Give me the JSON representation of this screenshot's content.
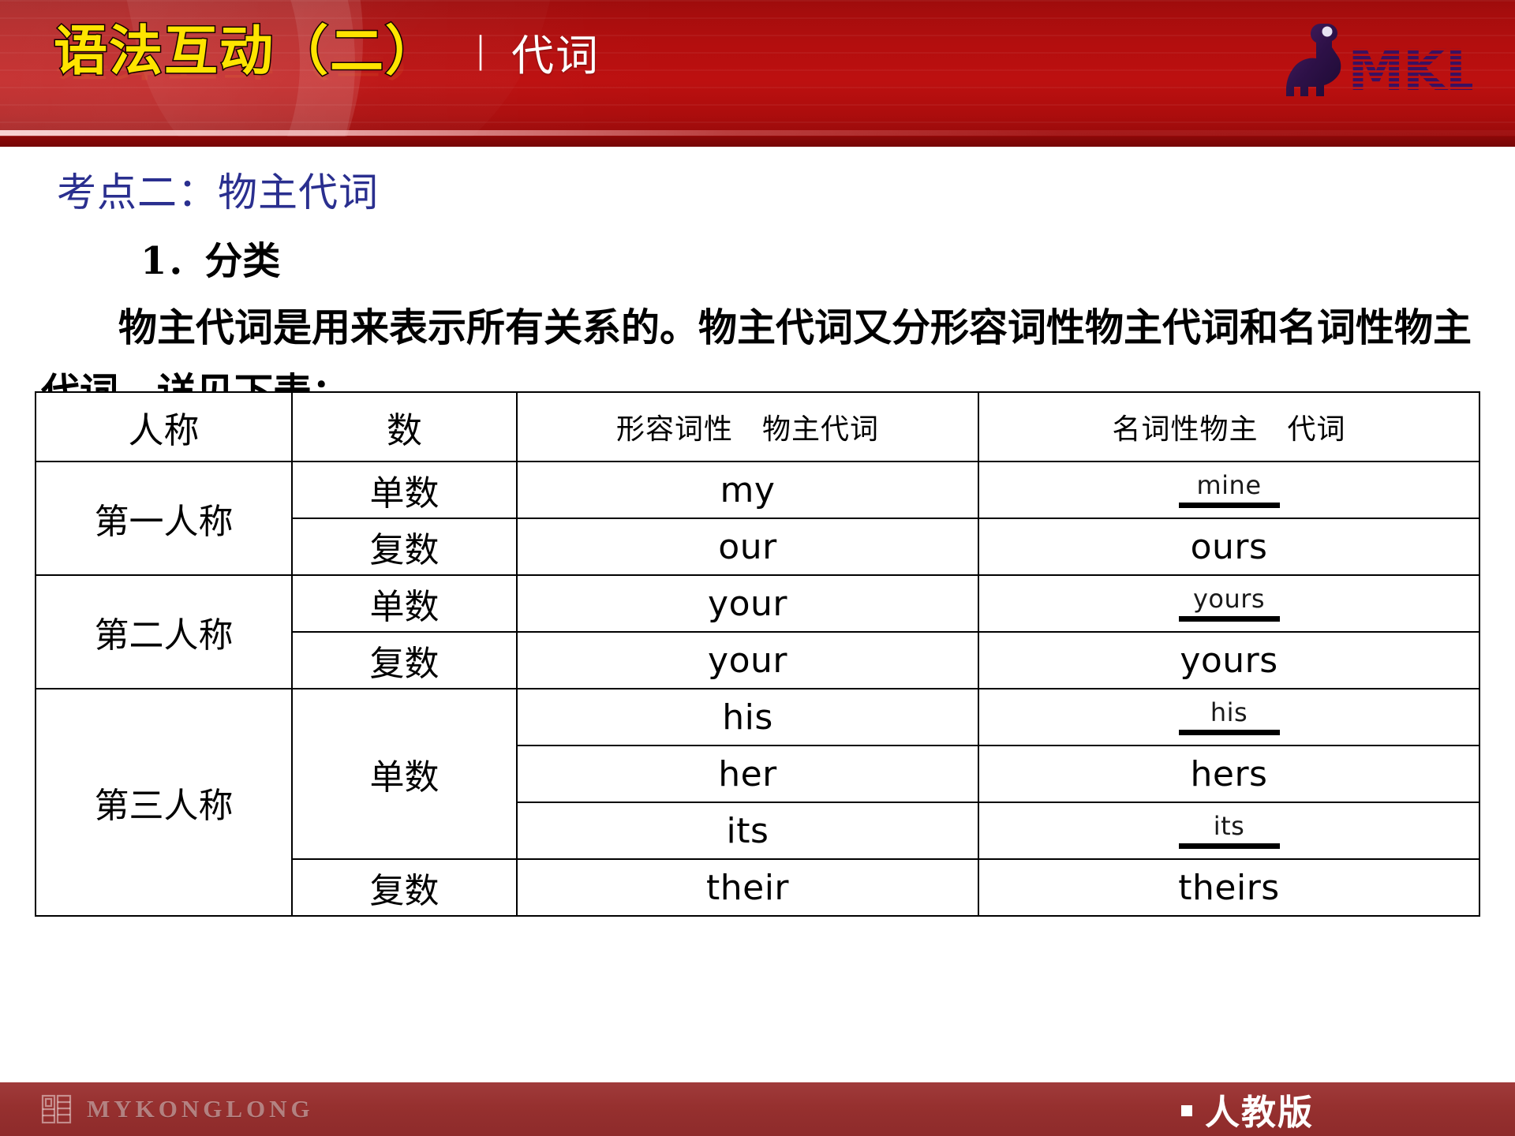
{
  "header": {
    "title_main": "语法互动（二）",
    "separator": "|",
    "title_sub": "代词",
    "logo_text": "MKL",
    "logo_icon": "dinosaur-icon",
    "bg_color": "#b30e0e",
    "title_color": "#ffe400"
  },
  "content": {
    "section_heading": "考点二：物主代词",
    "point_number": "1．分类",
    "paragraph_line1": "物主代词是用来表示所有关系的。物主代词又分形容词性物",
    "paragraph_line2": "主代词和名词性物主代词。详见下表："
  },
  "table": {
    "headers": {
      "person": "人称",
      "number": "数",
      "adjective": "形容词性　物主代词",
      "noun": "名词性物主　代词"
    },
    "rows": [
      {
        "person": "第一人称",
        "person_rowspan": 2,
        "number": "单数",
        "number_rowspan": 1,
        "adjective": "my",
        "noun": "mine",
        "noun_blank": true
      },
      {
        "person": "",
        "number": "复数",
        "number_rowspan": 1,
        "adjective": "our",
        "noun": "ours",
        "noun_blank": false
      },
      {
        "person": "第二人称",
        "person_rowspan": 2,
        "number": "单数",
        "number_rowspan": 1,
        "adjective": "your",
        "noun": "yours",
        "noun_blank": true
      },
      {
        "person": "",
        "number": "复数",
        "number_rowspan": 1,
        "adjective": "your",
        "noun": "yours",
        "noun_blank": false
      },
      {
        "person": "第三人称",
        "person_rowspan": 4,
        "number": "单数",
        "number_rowspan": 3,
        "adjective": "his",
        "noun": "his",
        "noun_blank": true
      },
      {
        "person": "",
        "number": "",
        "adjective": "her",
        "noun": "hers",
        "noun_blank": false
      },
      {
        "person": "",
        "number": "",
        "adjective": "its",
        "noun": "its",
        "noun_blank": true
      },
      {
        "person": "",
        "number": "复数",
        "number_rowspan": 1,
        "adjective": "their",
        "noun": "theirs",
        "noun_blank": false
      }
    ]
  },
  "footer": {
    "brand": "MYKONGLONG",
    "brand_icon": "seal-logo-icon",
    "bullet_icon": "square-bullet-icon",
    "edition": "人教版",
    "bg_color": "#96302f"
  }
}
